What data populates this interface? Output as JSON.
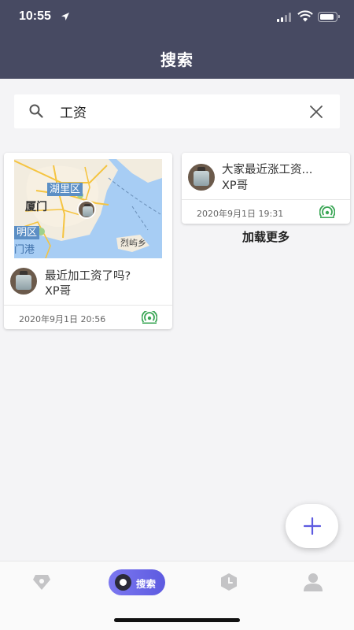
{
  "status_bar": {
    "time": "10:55"
  },
  "header": {
    "title": "搜索"
  },
  "search": {
    "value": "工资",
    "placeholder": ""
  },
  "posts": [
    {
      "title": "最近加工资了吗?",
      "author": "XP哥",
      "time": "2020年9月1日 20:56",
      "map_labels": {
        "district1": "湖里区",
        "city": "厦门",
        "district2": "明区",
        "harbor": "门港",
        "islet": "烈屿乡"
      }
    },
    {
      "title": "大家最近涨工资...",
      "author": "XP哥",
      "time": "2020年9月1日 19:31"
    }
  ],
  "load_more": "加载更多",
  "tabbar": {
    "tabs": [
      {
        "name": "discover",
        "icon": "gem-icon"
      },
      {
        "name": "search",
        "icon": "search-bubble-icon",
        "label": "搜索"
      },
      {
        "name": "history",
        "icon": "clock-icon"
      },
      {
        "name": "profile",
        "icon": "person-icon"
      }
    ]
  },
  "colors": {
    "header_bg": "#474a62",
    "accent": "#5d5ae0",
    "signal_green": "#3aa655",
    "page_bg": "#f4f4f6"
  }
}
